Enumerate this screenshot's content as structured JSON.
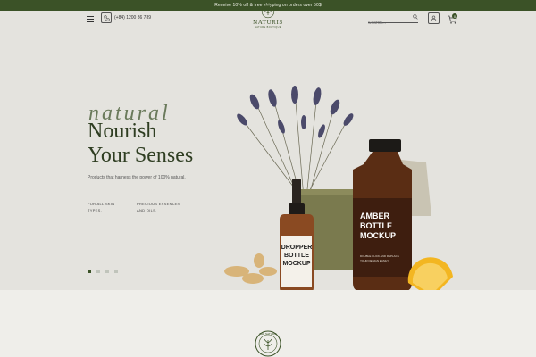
{
  "topbar": {
    "promo": "Receive 10% off & free shipping on orders over 50$"
  },
  "header": {
    "phone": "(+84) 1200 86 789",
    "logo_name": "NATURIS",
    "logo_sub": "NATURE BOUTIQUE",
    "search_placeholder": "Search...",
    "cart_count": "0"
  },
  "hero": {
    "script": "natural",
    "headline_line1": "Nourish",
    "headline_line2": "Your Senses",
    "tagline": "Products that harness the power of 100% natural.",
    "feature_1": "FOR ALL SKIN TYPES.",
    "feature_2": "PRECIOUS ESSENCES AND OILS.",
    "slides": 4,
    "active_slide": 1
  },
  "products": {
    "dropper_line1": "DROPPER",
    "dropper_line2": "BOTTLE",
    "dropper_line3": "MOCKUP",
    "amber_line1": "AMBER",
    "amber_line2": "BOTTLE",
    "amber_line3": "MOCKUP",
    "amber_small1": "DOUBLE CLICK AND REPLACE",
    "amber_small2": "YOUR DESIGN EASILY"
  },
  "footer": {
    "logo_text": "THE NATURIS"
  },
  "colors": {
    "brand": "#3b5227",
    "background": "#e4e3de"
  }
}
